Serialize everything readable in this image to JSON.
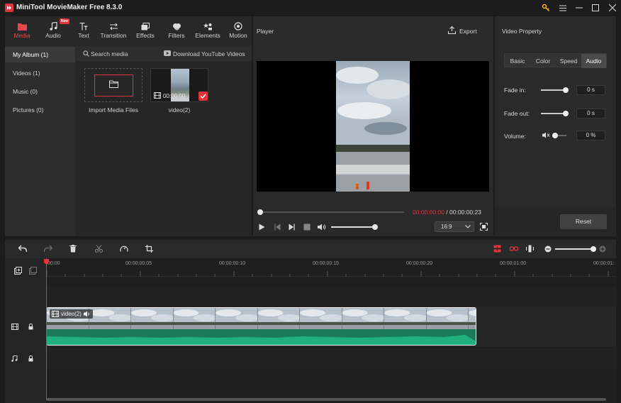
{
  "app": {
    "title": "MiniTool MovieMaker Free 8.3.0"
  },
  "window_controls": {
    "key": "key-icon",
    "menu": "menu-icon",
    "minimize": "minimize-icon",
    "maximize": "maximize-icon",
    "close": "close-icon"
  },
  "toolbar": {
    "items": [
      {
        "label": "Media",
        "icon": "media-folder-icon",
        "active": true
      },
      {
        "label": "Audio",
        "icon": "music-note-icon",
        "badge": "New"
      },
      {
        "label": "Text",
        "icon": "text-icon"
      },
      {
        "label": "Transition",
        "icon": "transition-icon"
      },
      {
        "label": "Effects",
        "icon": "effects-icon"
      },
      {
        "label": "Filters",
        "icon": "filters-icon"
      },
      {
        "label": "Elements",
        "icon": "elements-icon"
      },
      {
        "label": "Motion",
        "icon": "motion-icon"
      }
    ]
  },
  "album": {
    "items": [
      {
        "label": "My Album (1)",
        "active": true
      },
      {
        "label": "Videos (1)"
      },
      {
        "label": "Music (0)"
      },
      {
        "label": "Pictures (0)"
      }
    ]
  },
  "media": {
    "search_label": "Search media",
    "download_label": "Download YouTube Videos",
    "import_label": "Import Media Files",
    "clip_name": "video(2)",
    "clip_duration": "00:00:00"
  },
  "player": {
    "title": "Player",
    "export_label": "Export",
    "current_time": "00:00:00:00",
    "separator": " / ",
    "total_time": "00:00:00:23",
    "progress": 0,
    "volume": 1.0,
    "aspect_ratio": "16:9"
  },
  "property": {
    "title": "Video Property",
    "tabs": [
      {
        "label": "Basic"
      },
      {
        "label": "Color"
      },
      {
        "label": "Speed"
      },
      {
        "label": "Audio",
        "active": true
      }
    ],
    "fade_in_label": "Fade in:",
    "fade_in_value": "0 s",
    "fade_out_label": "Fade out:",
    "fade_out_value": "0 s",
    "volume_label": "Volume:",
    "volume_value": "0 %",
    "reset_label": "Reset"
  },
  "timeline": {
    "ruler": [
      "00:00",
      "00:00:00:05",
      "00:00:00:10",
      "00:00:00:15",
      "00:00:00:20",
      "00:00:01:00",
      "00:00:01:"
    ],
    "clip_label": "video(2)"
  },
  "colors": {
    "accent": "#e0353d",
    "time_red": "#e0353d",
    "audio_wave": "#1fb07e",
    "waveform_bg": "#1a7a5a"
  }
}
